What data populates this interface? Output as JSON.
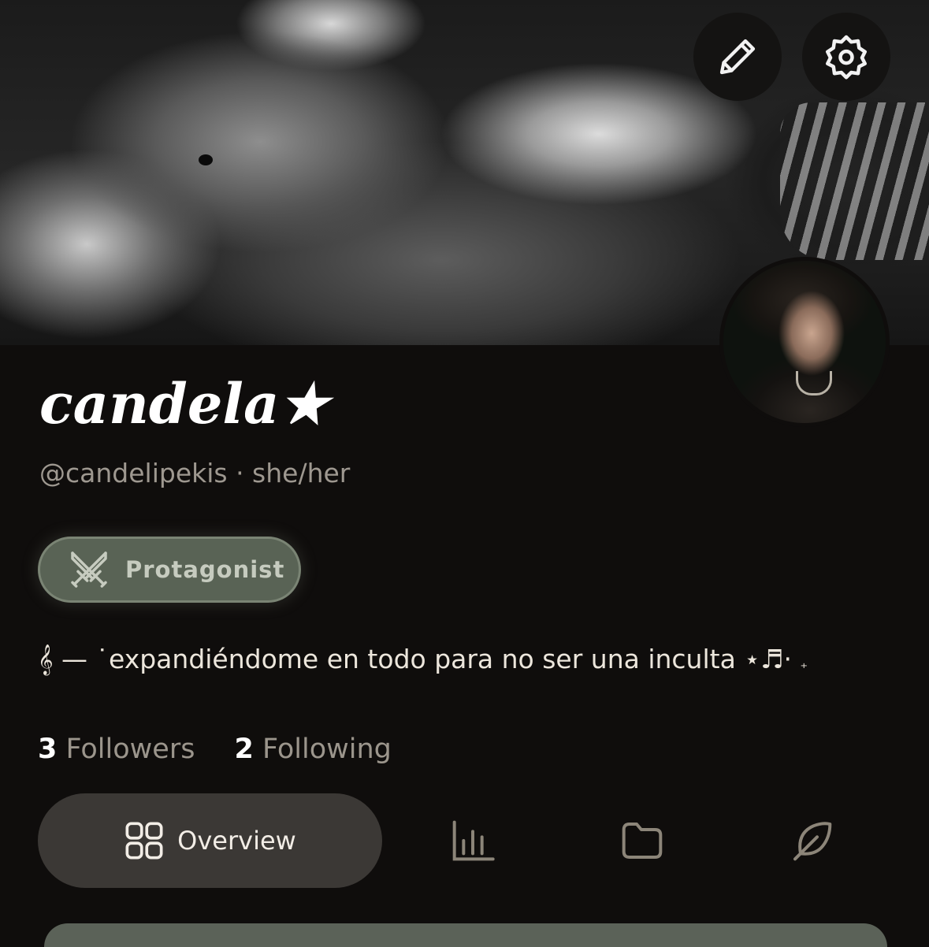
{
  "header": {
    "edit_icon": "pencil-icon",
    "settings_icon": "gear-icon"
  },
  "profile": {
    "display_name": "candela★",
    "handle_line": "@candelipekis · she/her",
    "badge": {
      "icon": "crossed-swords-icon",
      "label": "Protagonist"
    },
    "bio": {
      "main": "𝄞 — ˙expandiéndome en todo para no ser una inculta ⋆♬·",
      "trail": "₊"
    },
    "stats": {
      "followers_count": "3",
      "followers_label": "Followers",
      "following_count": "2",
      "following_label": "Following"
    }
  },
  "tabs": {
    "overview_label": "Overview",
    "items": [
      "grid-icon",
      "bar-chart-icon",
      "folder-icon",
      "feather-icon"
    ]
  },
  "colors": {
    "background": "#0f0d0c",
    "badge_bg": "#596355",
    "active_tab_bg": "#3b3835",
    "muted_text": "#9b958c"
  }
}
